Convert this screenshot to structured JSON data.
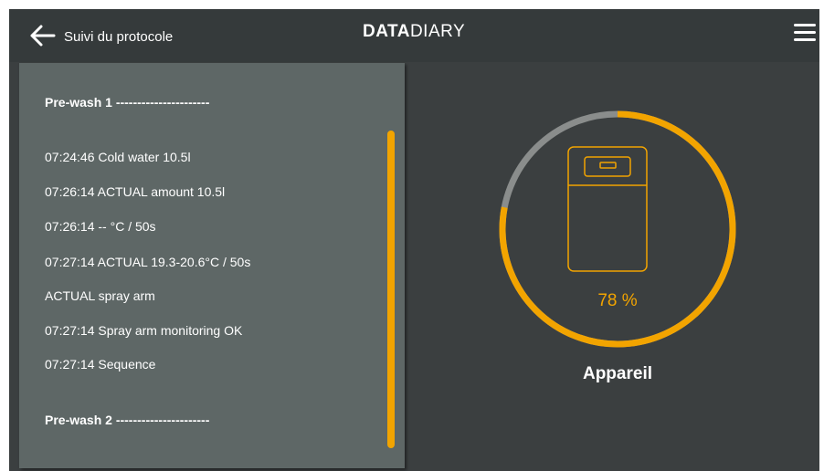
{
  "header": {
    "title": "Suivi du protocole",
    "logo_bold": "DATA",
    "logo_light": "DIARY"
  },
  "protocol": {
    "lines": [
      {
        "text": "Pre-wash 1 ----------------------",
        "style": "head"
      },
      {
        "text": "07:24:46 Cold water 10.5l",
        "style": "normal"
      },
      {
        "text": "07:26:14 ACTUAL amount 10.5l",
        "style": "normal"
      },
      {
        "text": "07:26:14 -- °C / 50s",
        "style": "normal"
      },
      {
        "text": "07:27:14 ACTUAL 19.3-20.6°C / 50s",
        "style": "normal"
      },
      {
        "text": "ACTUAL spray arm",
        "style": "normal"
      },
      {
        "text": "07:27:14 Spray arm monitoring OK",
        "style": "normal"
      },
      {
        "text": "07:27:14 Sequence",
        "style": "normal"
      },
      {
        "text": "Pre-wash 2 ----------------------",
        "style": "head"
      }
    ]
  },
  "device": {
    "progress": 0.78,
    "progress_label": "78 %",
    "label": "Appareil"
  },
  "colors": {
    "accent": "#f2a400",
    "track": "#8a8d8c",
    "panel": "#5e6766",
    "background": "#3b3f40"
  },
  "icons": {
    "back": "arrow-left-icon",
    "menu": "hamburger-menu-icon",
    "device": "washer-disinfector-icon"
  }
}
